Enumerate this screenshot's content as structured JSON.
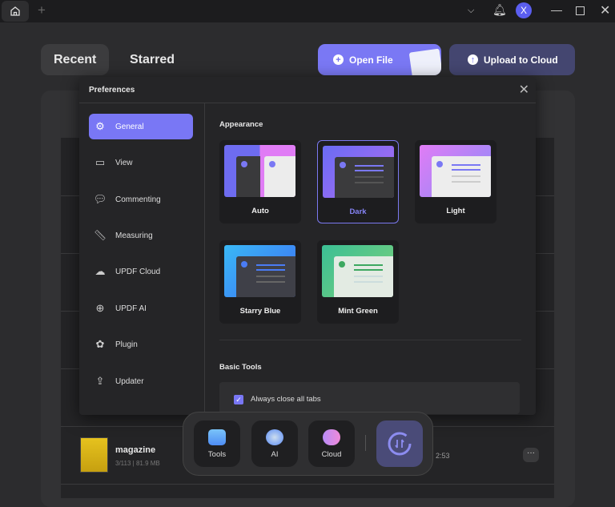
{
  "titlebar": {
    "avatar_letter": "X"
  },
  "tabs": [
    {
      "label": "Recent"
    },
    {
      "label": "Starred"
    }
  ],
  "actions": {
    "open_file": "Open File",
    "upload": "Upload to Cloud"
  },
  "file": {
    "name": "magazine",
    "meta": "3/113 | 81.9 MB",
    "time": "2:53"
  },
  "preferences": {
    "title": "Preferences",
    "sidebar": [
      {
        "label": "General"
      },
      {
        "label": "View"
      },
      {
        "label": "Commenting"
      },
      {
        "label": "Measuring"
      },
      {
        "label": "UPDF Cloud"
      },
      {
        "label": "UPDF AI"
      },
      {
        "label": "Plugin"
      },
      {
        "label": "Updater"
      }
    ],
    "appearance_title": "Appearance",
    "themes": [
      {
        "label": "Auto"
      },
      {
        "label": "Dark"
      },
      {
        "label": "Light"
      },
      {
        "label": "Starry Blue"
      },
      {
        "label": "Mint Green"
      }
    ],
    "selected_theme": "Dark",
    "basic_tools_title": "Basic Tools",
    "always_close_tabs": {
      "label": "Always close all tabs",
      "checked": true
    }
  },
  "dock": [
    {
      "label": "Tools"
    },
    {
      "label": "AI"
    },
    {
      "label": "Cloud"
    }
  ],
  "colors": {
    "accent": "#7977f5"
  }
}
